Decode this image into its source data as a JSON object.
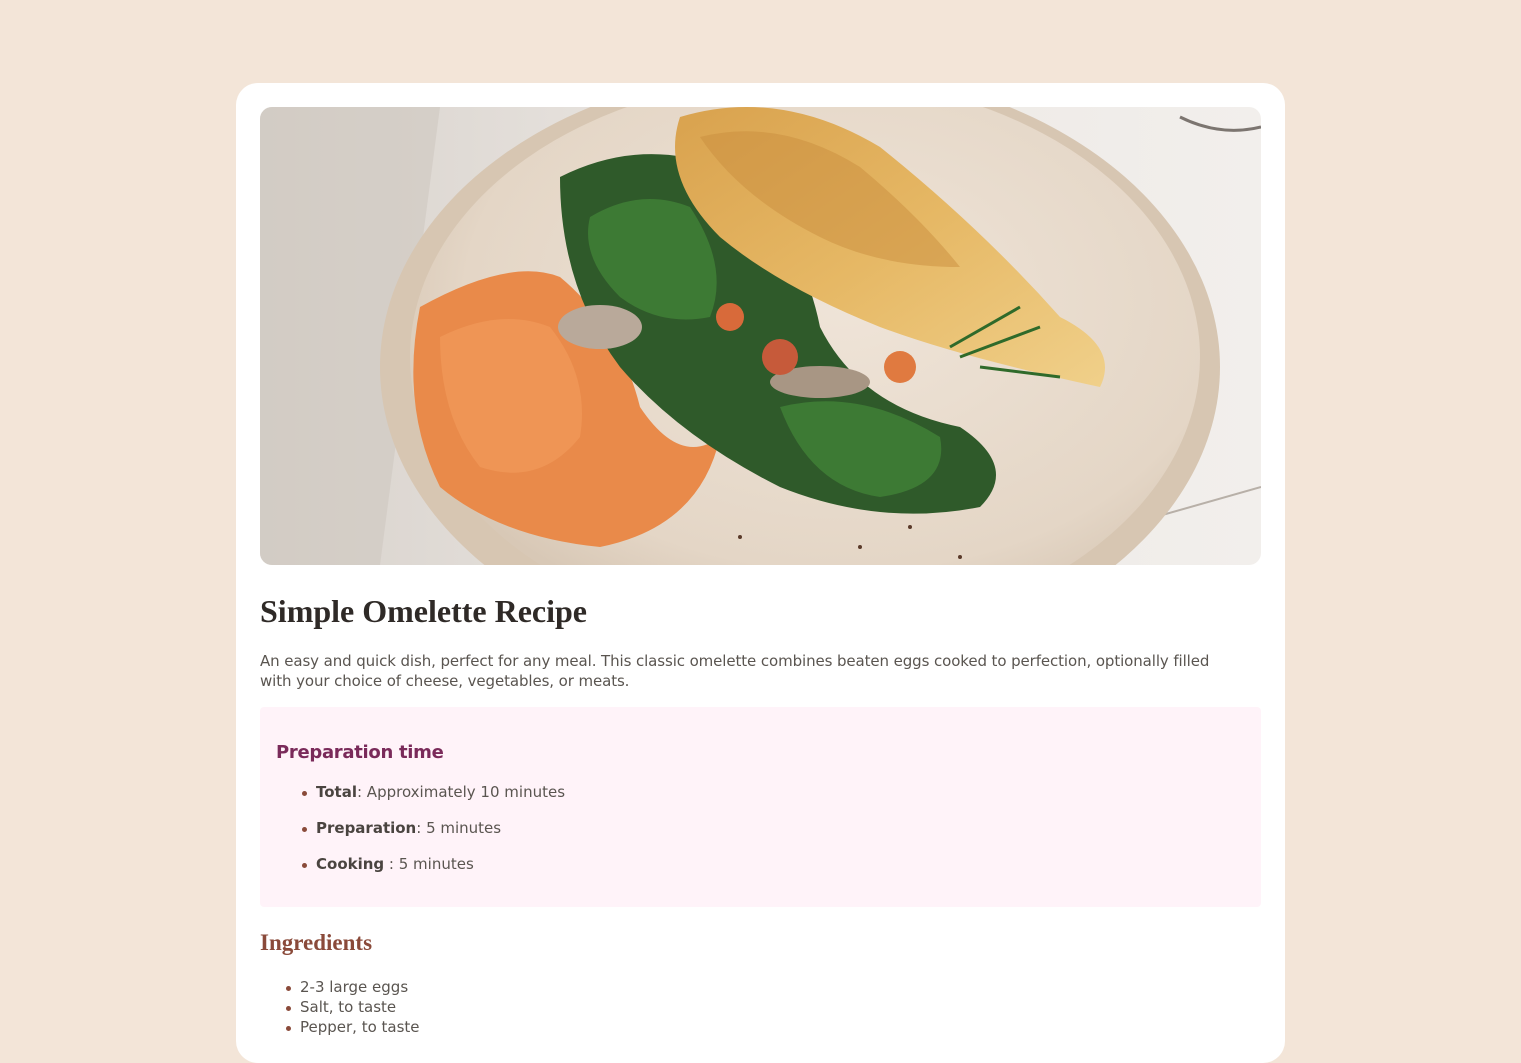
{
  "recipe": {
    "image_alt": "Omelette on a plate with spinach, mushrooms and orange spread",
    "title": "Simple Omelette Recipe",
    "description": "An easy and quick dish, perfect for any meal. This classic omelette combines beaten eggs cooked to perfection, optionally filled with your choice of cheese, vegetables, or meats.",
    "preparation": {
      "heading": "Preparation time",
      "items": [
        {
          "label": "Total",
          "value": ": Approximately 10 minutes"
        },
        {
          "label": "Preparation",
          "value": ": 5 minutes"
        },
        {
          "label": "Cooking",
          "value": " : 5 minutes"
        }
      ]
    },
    "ingredients": {
      "heading": "Ingredients",
      "items": [
        "2-3 large eggs",
        "Salt, to taste",
        "Pepper, to taste"
      ]
    }
  },
  "colors": {
    "page_background": "#f3e5d8",
    "card": "#ffffff",
    "prep_background": "#fff3f9",
    "prep_heading": "#7a2a5a",
    "ingredients_heading": "#8a4a3a"
  }
}
